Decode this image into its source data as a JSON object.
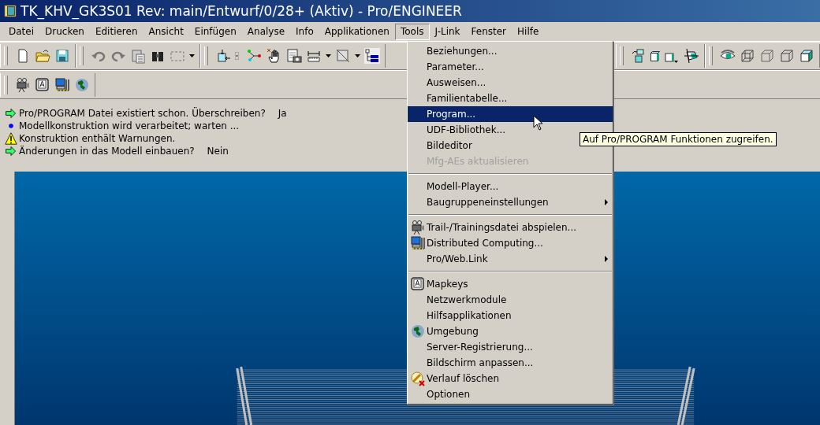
{
  "window": {
    "title": "TK_KHV_GK3S01 Rev: main/Entwurf/0/28+ (Aktiv) - Pro/ENGINEER"
  },
  "menu_bar": [
    {
      "label": "Datei",
      "selected": false
    },
    {
      "label": "Drucken",
      "selected": false
    },
    {
      "label": "Editieren",
      "selected": false
    },
    {
      "label": "Ansicht",
      "selected": false
    },
    {
      "label": "Einfügen",
      "selected": false
    },
    {
      "label": "Analyse",
      "selected": false
    },
    {
      "label": "Info",
      "selected": false
    },
    {
      "label": "Applikationen",
      "selected": false
    },
    {
      "label": "Tools",
      "selected": true
    },
    {
      "label": "J-Link",
      "selected": false
    },
    {
      "label": "Fenster",
      "selected": false
    },
    {
      "label": "Hilfe",
      "selected": false
    }
  ],
  "messages": [
    {
      "kind": "prompt",
      "text": "Pro/PROGRAM Datei existiert schon. Überschreiben?",
      "answer": "Ja"
    },
    {
      "kind": "info",
      "text": "Modellkonstruktion wird verarbeitet; warten ..."
    },
    {
      "kind": "warning",
      "text": "Konstruktion enthält Warnungen."
    },
    {
      "kind": "prompt",
      "text": "Änderungen in das Modell einbauen?",
      "answer": "Nein"
    }
  ],
  "tools_menu": {
    "groups": [
      [
        {
          "label": "Beziehungen...",
          "selected": false,
          "disabled": false
        },
        {
          "label": "Parameter...",
          "selected": false,
          "disabled": false
        },
        {
          "label": "Ausweisen...",
          "selected": false,
          "disabled": false
        },
        {
          "label": "Familientabelle...",
          "selected": false,
          "disabled": false
        },
        {
          "label": "Program...",
          "selected": true,
          "disabled": false
        },
        {
          "label": "UDF-Bibliothek...",
          "selected": false,
          "disabled": false
        },
        {
          "label": "Bildeditor",
          "selected": false,
          "disabled": false
        },
        {
          "label": "Mfg-AEs aktualisieren",
          "selected": false,
          "disabled": true
        }
      ],
      [
        {
          "label": "Modell-Player...",
          "selected": false,
          "disabled": false
        },
        {
          "label": "Baugruppeneinstellungen",
          "selected": false,
          "disabled": false,
          "submenu": true
        }
      ],
      [
        {
          "label": "Trail-/Trainingsdatei abspielen...",
          "selected": false,
          "disabled": false
        },
        {
          "label": "Distributed Computing...",
          "selected": false,
          "disabled": false
        },
        {
          "label": "Pro/Web.Link",
          "selected": false,
          "disabled": false,
          "submenu": true
        }
      ],
      [
        {
          "label": "Mapkeys",
          "selected": false,
          "disabled": false
        },
        {
          "label": "Netzwerkmodule",
          "selected": false,
          "disabled": false
        },
        {
          "label": "Hilfsapplikationen",
          "selected": false,
          "disabled": false
        },
        {
          "label": "Umgebung",
          "selected": false,
          "disabled": false
        },
        {
          "label": "Server-Registrierung...",
          "selected": false,
          "disabled": false
        },
        {
          "label": "Bildschirm anpassen...",
          "selected": false,
          "disabled": false
        },
        {
          "label": "Verlauf löschen",
          "selected": false,
          "disabled": false
        },
        {
          "label": "Optionen",
          "selected": false,
          "disabled": false
        }
      ]
    ]
  },
  "tooltip": "Auf Pro/PROGRAM Funktionen zugreifen."
}
